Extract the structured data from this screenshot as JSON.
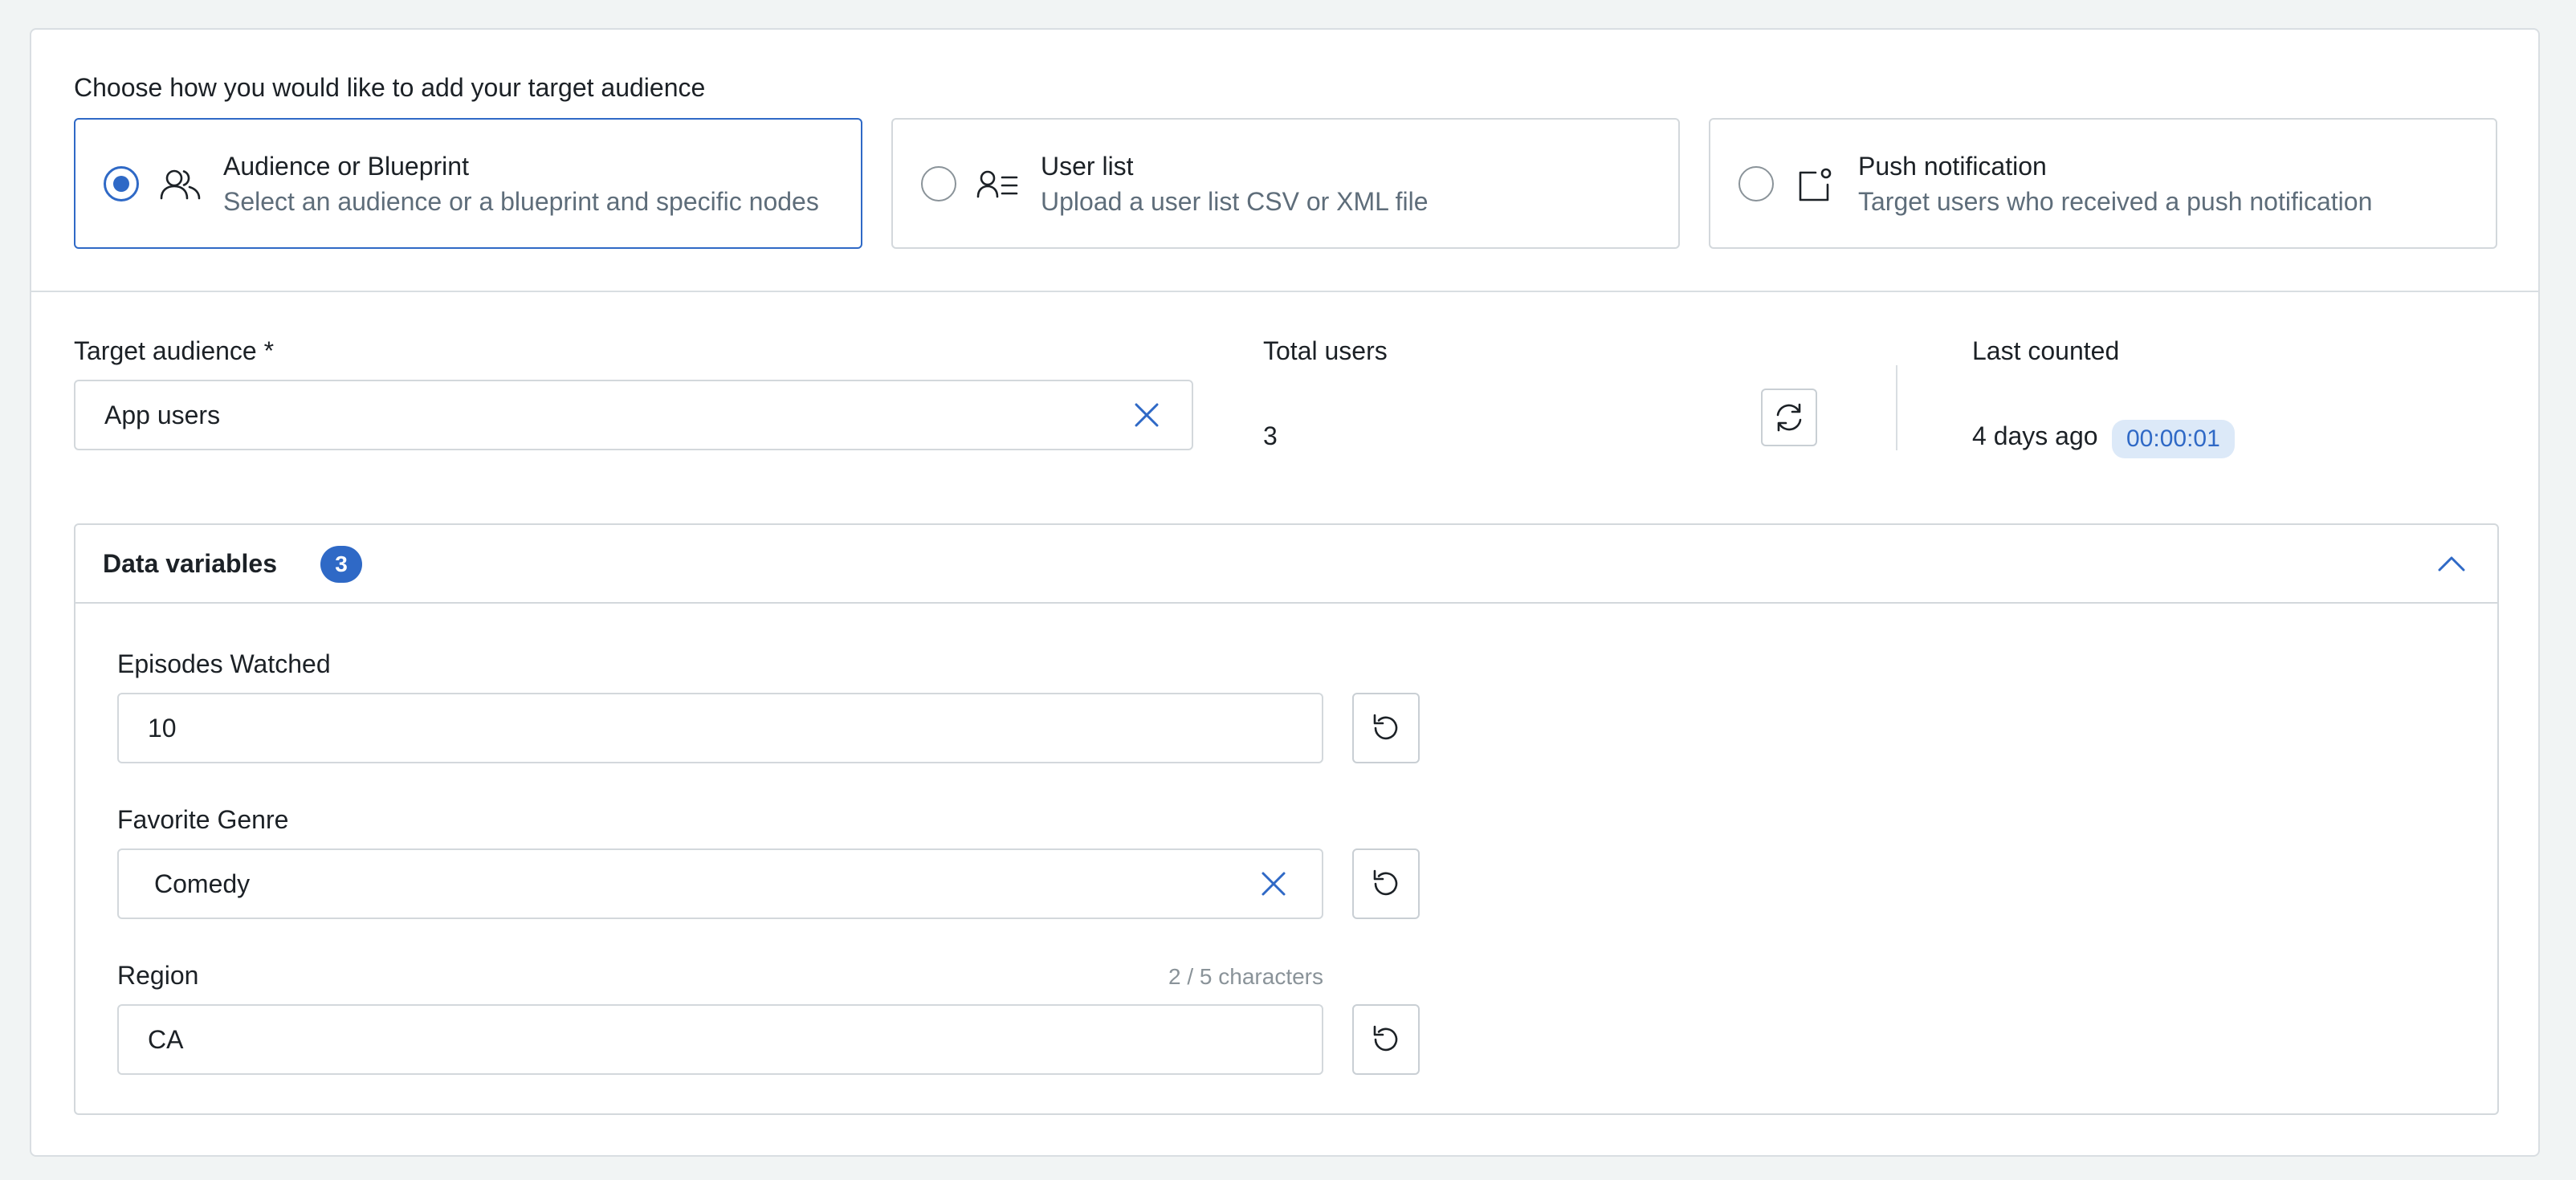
{
  "audience_method": {
    "title": "Choose how you would like to add your target audience",
    "options": [
      {
        "title": "Audience or Blueprint",
        "description": "Select an audience or a blueprint and specific nodes",
        "selected": true,
        "icon": "group-icon"
      },
      {
        "title": "User list",
        "description": "Upload a user list CSV or XML file",
        "selected": false,
        "icon": "user-list-icon"
      },
      {
        "title": "Push notification",
        "description": "Target users who received a push notification",
        "selected": false,
        "icon": "push-notification-icon"
      }
    ]
  },
  "target_audience": {
    "label": "Target audience *",
    "value": "App users"
  },
  "total_users": {
    "label": "Total users",
    "value": "3"
  },
  "last_counted": {
    "label": "Last counted",
    "value": "4 days ago",
    "duration": "00:00:01"
  },
  "data_variables": {
    "title": "Data variables",
    "count": "3",
    "expanded": true,
    "fields": [
      {
        "label": "Episodes Watched",
        "value": "10"
      },
      {
        "label": "Favorite Genre",
        "value": "Comedy"
      },
      {
        "label": "Region",
        "value": "CA",
        "char_count": "2 / 5 characters"
      }
    ]
  },
  "colors": {
    "accent": "#2f69c6",
    "badge_bg": "#dce9f8",
    "border": "#d3d8dc",
    "page_bg": "#f1f4f4"
  }
}
